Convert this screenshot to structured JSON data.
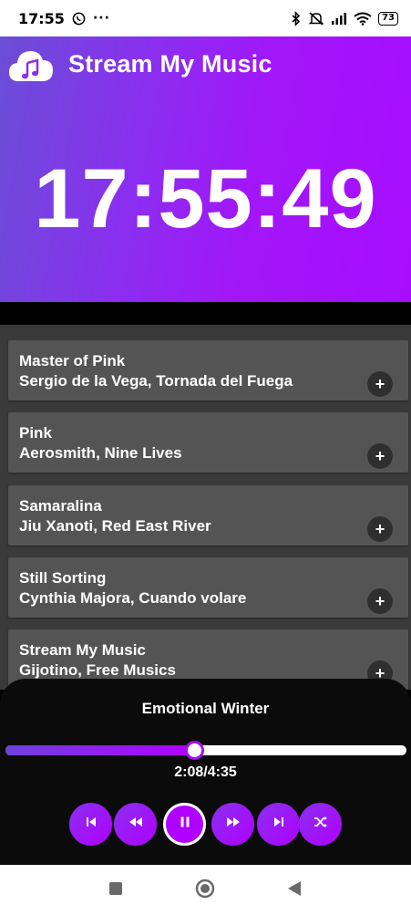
{
  "status_bar": {
    "time": "17:55",
    "battery": "73",
    "icons": [
      "whatsapp-icon",
      "more-icon",
      "bluetooth-icon",
      "mute-icon",
      "signal-icon",
      "wifi-icon",
      "battery-icon"
    ]
  },
  "header": {
    "app_title": "Stream My Music",
    "clock": "17:55:49",
    "logo_icon": "cloud-music-icon",
    "gradient_start": "#6a4ed6",
    "gradient_end": "#a80cff"
  },
  "songs": [
    {
      "title": "Master of Pink",
      "artist": "Sergio de la Vega, Tornada del Fuega",
      "action": "+"
    },
    {
      "title": "Pink",
      "artist": "Aerosmith, Nine Lives",
      "action": "+"
    },
    {
      "title": "Samaralina",
      "artist": "Jiu Xanoti, Red East River",
      "action": "+"
    },
    {
      "title": "Still Sorting",
      "artist": "Cynthia Majora, Cuando volare",
      "action": "+"
    },
    {
      "title": "Stream My Music",
      "artist": "Gijotino, Free Musics",
      "action": "+"
    }
  ],
  "player": {
    "now_playing": "Emotional Winter",
    "time_readout": "2:08/4:35",
    "progress": 0.47,
    "accent": "#a50cff",
    "controls": [
      "skip-previous-icon",
      "rewind-icon",
      "pause-icon",
      "fast-forward-icon",
      "skip-next-icon",
      "shuffle-icon"
    ]
  },
  "nav": {
    "buttons": [
      "recents-icon",
      "home-icon",
      "back-icon"
    ]
  }
}
